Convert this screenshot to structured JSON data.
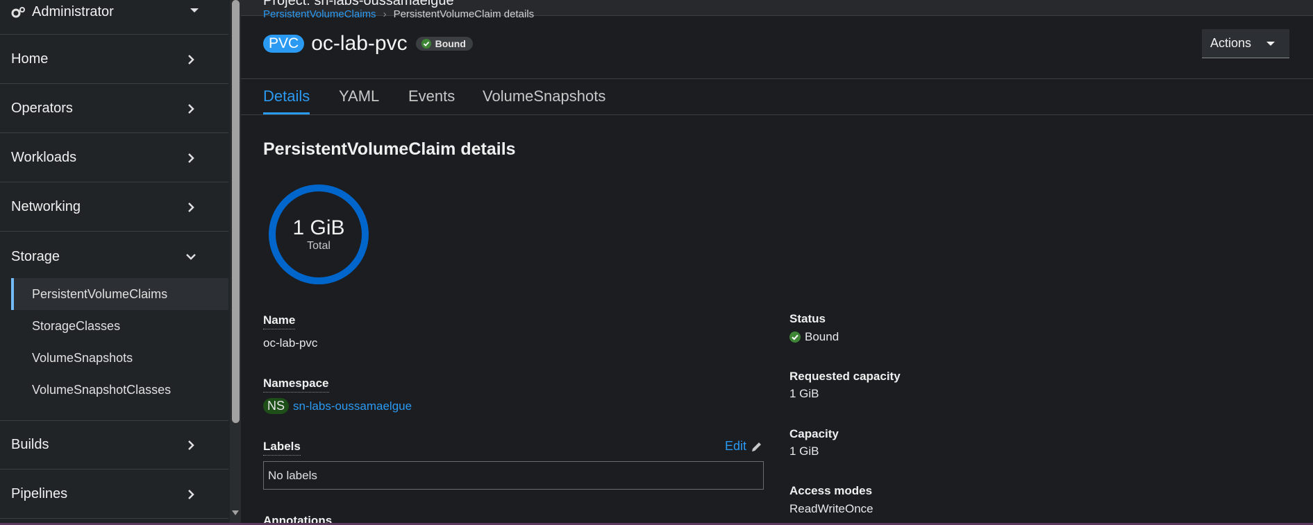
{
  "sidebar": {
    "perspective": "Administrator",
    "nav": [
      {
        "label": "Home"
      },
      {
        "label": "Operators"
      },
      {
        "label": "Workloads"
      },
      {
        "label": "Networking"
      },
      {
        "label": "Storage"
      },
      {
        "label": "Builds"
      },
      {
        "label": "Pipelines"
      }
    ],
    "storage_items": [
      {
        "label": "PersistentVolumeClaims"
      },
      {
        "label": "StorageClasses"
      },
      {
        "label": "VolumeSnapshots"
      },
      {
        "label": "VolumeSnapshotClasses"
      }
    ]
  },
  "header": {
    "project": "Project: sn-labs-oussamaelgue",
    "breadcrumb_link": "PersistentVolumeClaims",
    "breadcrumb_current": "PersistentVolumeClaim details",
    "kind_badge": "PVC",
    "resource_name": "oc-lab-pvc",
    "status": "Bound",
    "actions_label": "Actions"
  },
  "tabs": [
    {
      "label": "Details"
    },
    {
      "label": "YAML"
    },
    {
      "label": "Events"
    },
    {
      "label": "VolumeSnapshots"
    }
  ],
  "details": {
    "section_title": "PersistentVolumeClaim details",
    "donut_value": "1 GiB",
    "donut_label": "Total",
    "name_label": "Name",
    "name_value": "oc-lab-pvc",
    "namespace_label": "Namespace",
    "namespace_badge": "NS",
    "namespace_value": "sn-labs-oussamaelgue",
    "labels_label": "Labels",
    "edit_label": "Edit",
    "labels_value": "No labels",
    "annotations_label": "Annotations",
    "status_label": "Status",
    "status_value": "Bound",
    "requested_capacity_label": "Requested capacity",
    "requested_capacity_value": "1 GiB",
    "capacity_label": "Capacity",
    "capacity_value": "1 GiB",
    "access_modes_label": "Access modes",
    "access_modes_value": "ReadWriteOnce"
  },
  "colors": {
    "accent": "#2b9af3",
    "success": "#3e8635",
    "donut": "#0066cc",
    "sidebar_bg": "#212427",
    "main_bg": "#1b1d21"
  }
}
